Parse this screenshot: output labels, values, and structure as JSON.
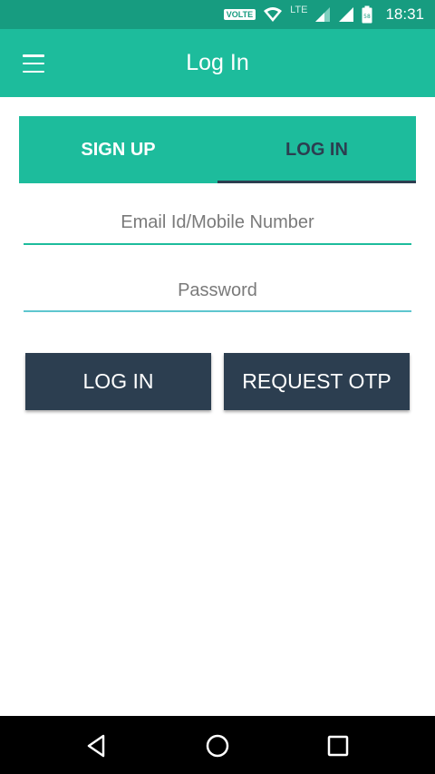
{
  "status_bar": {
    "volte": "VOLTE",
    "network": "LTE",
    "time": "18:31",
    "icons": [
      "wifi-icon",
      "signal-icon",
      "signal-full-icon",
      "battery-icon"
    ]
  },
  "app_bar": {
    "title": "Log In",
    "menu_icon": "menu-icon"
  },
  "tabs": [
    {
      "label": "SIGN UP",
      "selected": false
    },
    {
      "label": "LOG IN",
      "selected": true
    }
  ],
  "form": {
    "email_placeholder": "Email Id/Mobile Number",
    "email_value": "",
    "password_placeholder": "Password",
    "password_value": ""
  },
  "buttons": {
    "login_label": "LOG IN",
    "otp_label": "REQUEST OTP"
  },
  "nav_bar": {
    "icons": [
      "back-icon",
      "home-icon",
      "recents-icon"
    ]
  },
  "colors": {
    "status_bar": "#179c80",
    "primary": "#1dbc9c",
    "dark": "#2c3e50",
    "nav_bar": "#000000"
  }
}
